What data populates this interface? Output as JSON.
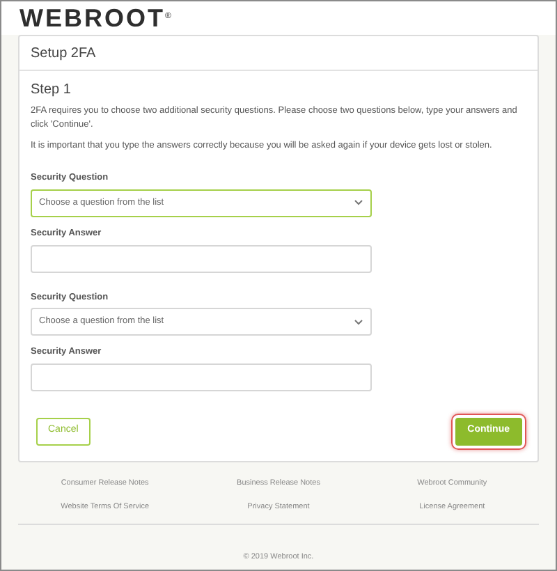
{
  "logo": {
    "text": "WEBROOT",
    "mark": "®"
  },
  "card": {
    "title": "Setup 2FA",
    "step": "Step 1",
    "paragraphs": [
      "2FA requires you to choose two additional security questions. Please choose two questions below, type your answers and click 'Continue'.",
      "It is important that you type the answers correctly because you will be asked again if your device gets lost or stolen."
    ],
    "groups": [
      {
        "question_label": "Security Question",
        "placeholder": "Choose a question from the list",
        "focused": true,
        "answer_label": "Security Answer"
      },
      {
        "question_label": "Security Question",
        "placeholder": "Choose a question from the list",
        "focused": false,
        "answer_label": "Security Answer"
      }
    ],
    "buttons": [
      {
        "label": "Cancel",
        "kind": "outline",
        "highlighted": false
      },
      {
        "label": "Continue",
        "kind": "primary",
        "highlighted": true
      }
    ]
  },
  "footer": {
    "links": [
      [
        "Consumer Release Notes",
        "Business Release Notes",
        "Webroot Community"
      ],
      [
        "Website Terms Of Service",
        "Privacy Statement",
        "License Agreement"
      ]
    ],
    "copyright": "© 2019 Webroot Inc."
  }
}
